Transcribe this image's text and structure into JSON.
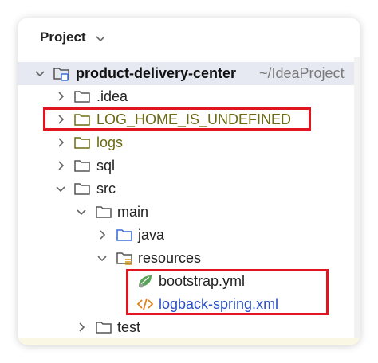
{
  "panel": {
    "title": "Project"
  },
  "tree": {
    "root": {
      "name": "product-delivery-center",
      "path": "~/IdeaProject"
    },
    "idea": ".idea",
    "log_home": "LOG_HOME_IS_UNDEFINED",
    "logs": "logs",
    "sql": "sql",
    "src": "src",
    "main": "main",
    "java": "java",
    "resources": "resources",
    "bootstrap": "bootstrap.yml",
    "logback": "logback-spring.xml",
    "test": "test"
  },
  "colors": {
    "highlight_box": "#e0151f",
    "excluded_folder_text": "#6d6a12",
    "modified_file_text": "#2b4fc4",
    "selected_row": "#e6e9f1"
  },
  "icons": [
    "chevron-down-icon",
    "chevron-right-icon",
    "folder-icon",
    "module-folder-icon",
    "source-folder-icon",
    "resources-folder-icon",
    "spring-leaf-icon",
    "xml-file-icon"
  ]
}
